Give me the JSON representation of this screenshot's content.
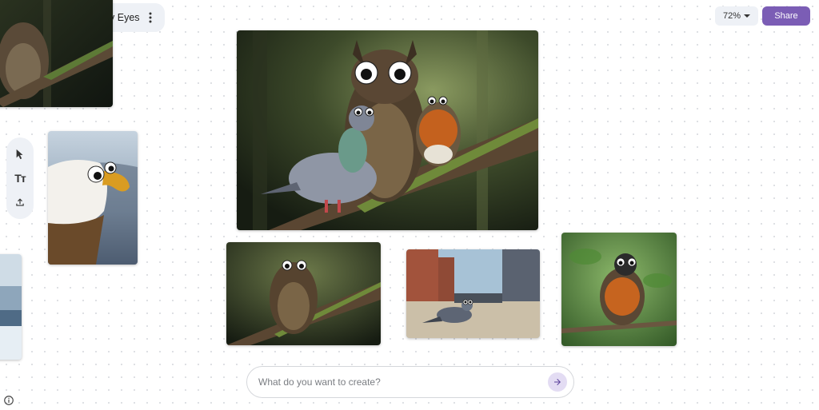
{
  "header": {
    "title": "Birds with Googly Eyes",
    "back_icon": "arrow-back-icon",
    "more_icon": "more-vert-icon"
  },
  "zoom": {
    "label": "72%"
  },
  "share": {
    "label": "Share"
  },
  "toolbar": {
    "tools": [
      {
        "name": "select-tool",
        "icon": "cursor-icon"
      },
      {
        "name": "text-tool",
        "icon": "text-icon",
        "label": "Tт"
      },
      {
        "name": "upload-tool",
        "icon": "upload-icon"
      }
    ]
  },
  "prompt": {
    "placeholder": "What do you want to create?"
  },
  "colors": {
    "accent": "#7b5db5",
    "send_bg": "#e3dcf3",
    "pill_bg": "#eef1f6"
  }
}
